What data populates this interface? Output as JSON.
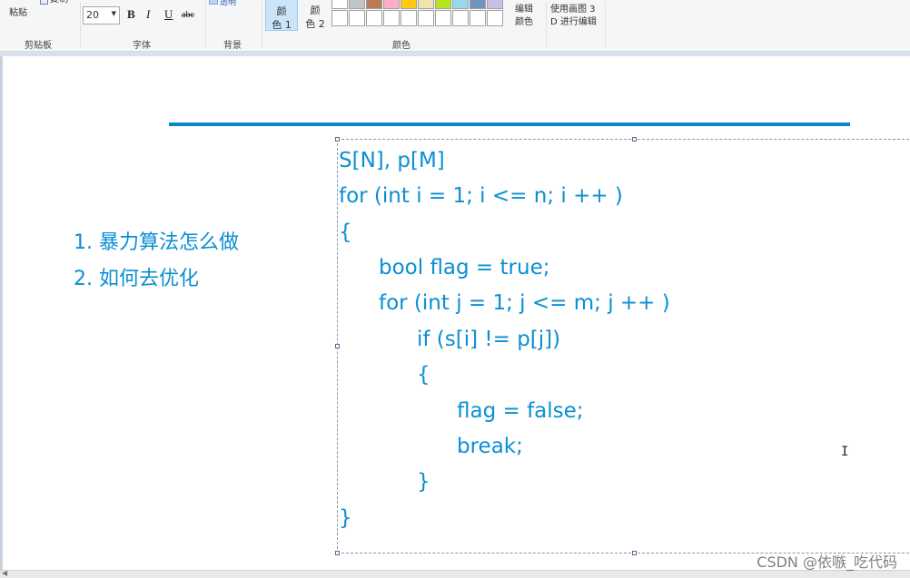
{
  "ribbon": {
    "clipboard": {
      "paste_label": "粘贴",
      "copy_label": "复制",
      "group_label": "剪贴板"
    },
    "font": {
      "size_value": "20",
      "bold_label": "B",
      "italic_label": "I",
      "underline_label": "U",
      "strike_label": "abc",
      "group_label": "字体"
    },
    "background": {
      "toggle_label": "透明",
      "group_label": "背景"
    },
    "colors": {
      "color1_label_line1": "颜",
      "color1_label_line2": "色 1",
      "color2_label_line1": "颜",
      "color2_label_line2": "色 2",
      "palette_row1": [
        "#ffffff",
        "#c3c3c3",
        "#b97a57",
        "#ffaec9",
        "#ffc90e",
        "#efe4b0",
        "#b5e61d",
        "#99d9ea",
        "#7092be",
        "#c8bfe7"
      ],
      "palette_row2": [
        "#ffffff",
        "#ffffff",
        "#ffffff",
        "#ffffff",
        "#ffffff",
        "#ffffff",
        "#ffffff",
        "#ffffff",
        "#ffffff",
        "#ffffff"
      ],
      "edit_label_line1": "编辑",
      "edit_label_line2": "颜色",
      "group_label": "颜色"
    },
    "paint3d": {
      "line1": "使用画图 3",
      "line2": "D 进行编辑"
    }
  },
  "canvas": {
    "outline": [
      "1. 暴力算法怎么做",
      "2. 如何去优化"
    ],
    "code_lines": [
      "S[N], p[M]",
      "for (int i = 1; i <= n; i ++ )",
      "{",
      "bool flag = true;",
      "for (int j = 1; j <= m; j ++ )",
      "if (s[i] != p[j])",
      "{",
      "flag = false;",
      "break;",
      "}",
      "}"
    ]
  },
  "watermark": "CSDN @依嗾_吃代码",
  "colors": {
    "accent_text": "#0b8fd1",
    "rule_line": "#0b86c9",
    "selected_color_bg": "#cce4f7"
  }
}
